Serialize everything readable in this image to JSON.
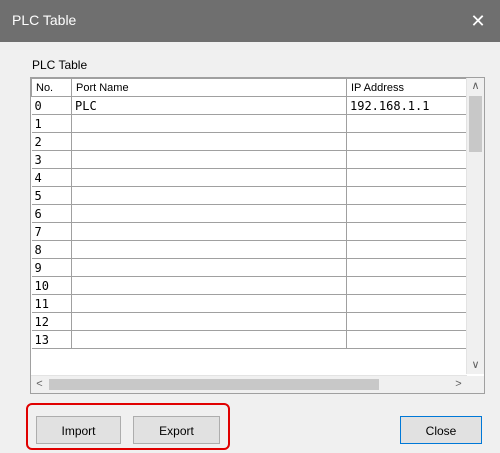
{
  "window": {
    "title": "PLC Table",
    "close_glyph": "✕"
  },
  "group": {
    "label": "PLC Table"
  },
  "table": {
    "columns": [
      "No.",
      "Port Name",
      "IP Address"
    ],
    "rows": [
      {
        "no": "0",
        "port": "PLC",
        "ip": "192.168.1.1"
      },
      {
        "no": "1",
        "port": "",
        "ip": ""
      },
      {
        "no": "2",
        "port": "",
        "ip": ""
      },
      {
        "no": "3",
        "port": "",
        "ip": ""
      },
      {
        "no": "4",
        "port": "",
        "ip": ""
      },
      {
        "no": "5",
        "port": "",
        "ip": ""
      },
      {
        "no": "6",
        "port": "",
        "ip": ""
      },
      {
        "no": "7",
        "port": "",
        "ip": ""
      },
      {
        "no": "8",
        "port": "",
        "ip": ""
      },
      {
        "no": "9",
        "port": "",
        "ip": ""
      },
      {
        "no": "10",
        "port": "",
        "ip": ""
      },
      {
        "no": "11",
        "port": "",
        "ip": ""
      },
      {
        "no": "12",
        "port": "",
        "ip": ""
      },
      {
        "no": "13",
        "port": "",
        "ip": ""
      }
    ]
  },
  "scrollbars": {
    "up": "∧",
    "down": "∨",
    "left": "<",
    "right": ">"
  },
  "buttons": {
    "import": "Import",
    "export": "Export",
    "close": "Close"
  },
  "colors": {
    "titlebar": "#6f6f6f",
    "highlight": "#e00000",
    "focus_border": "#0078d7"
  }
}
